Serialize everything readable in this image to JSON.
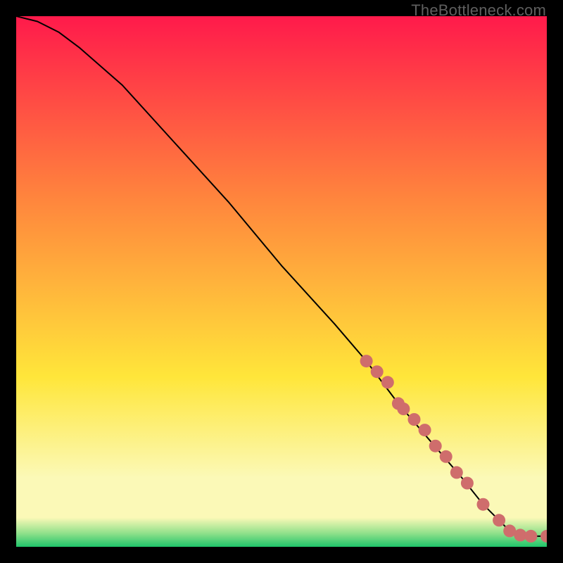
{
  "watermark": "TheBottleneck.com",
  "colors": {
    "top": "#ff1a4b",
    "mid1": "#ff843d",
    "mid2": "#ffe63a",
    "pale": "#fbf9b7",
    "green1": "#8ee08a",
    "green2": "#1fc46a",
    "curve": "#000000",
    "marker": "#cf6d6c"
  },
  "chart_data": {
    "type": "line",
    "title": "",
    "xlabel": "",
    "ylabel": "",
    "xlim": [
      0,
      100
    ],
    "ylim": [
      0,
      100
    ],
    "grid": false,
    "legend": false,
    "series": [
      {
        "name": "bottleneck-curve",
        "x": [
          0,
          4,
          8,
          12,
          20,
          30,
          40,
          50,
          60,
          66,
          72,
          78,
          84,
          88,
          91,
          93,
          95,
          97,
          100
        ],
        "values": [
          100,
          99,
          97,
          94,
          87,
          76,
          65,
          53,
          42,
          35,
          27,
          20,
          13,
          8,
          5,
          3,
          2.2,
          2.0,
          2.0
        ]
      }
    ],
    "markers": {
      "name": "sample-points",
      "x": [
        66,
        68,
        70,
        72,
        73,
        75,
        77,
        79,
        81,
        83,
        85,
        88,
        91,
        93,
        95,
        97,
        100
      ],
      "values": [
        35,
        33,
        31,
        27,
        26,
        24,
        22,
        19,
        17,
        14,
        12,
        8,
        5,
        3,
        2.2,
        2.0,
        2.0
      ]
    }
  }
}
